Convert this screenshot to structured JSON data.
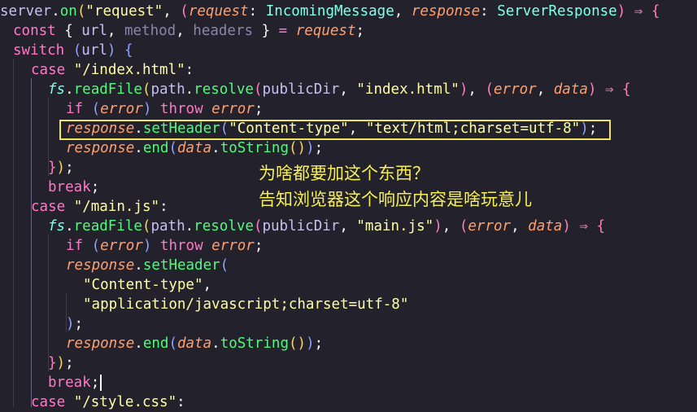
{
  "code": {
    "l1": {
      "t1": "server",
      "t2": ".",
      "t3": "on",
      "t4": "(",
      "t5": "\"request\"",
      "t6": ", ",
      "t7": "(",
      "t8": "request",
      "t9": ": ",
      "t10": "IncomingMessage",
      "t11": ", ",
      "t12": "response",
      "t13": ": ",
      "t14": "ServerResponse",
      "t15": ") ",
      "t16": "⇒",
      "t17": " ",
      "t18": "{"
    },
    "l2": {
      "t1": "const",
      "t2": " { ",
      "t3": "url",
      "t4": ", ",
      "t5": "method",
      "t6": ", ",
      "t7": "headers",
      "t8": " } ",
      "t9": "=",
      "t10": " ",
      "t11": "request",
      "t12": ";"
    },
    "l3": {
      "t1": "switch",
      "t2": " (",
      "t3": "url",
      "t4": ") ",
      "t5": "{"
    },
    "l4": {
      "t1": "case",
      "t2": " ",
      "t3": "\"/index.html\"",
      "t4": ":"
    },
    "l5": {
      "t1": "fs",
      "t2": ".",
      "t3": "readFile",
      "t4": "(",
      "t5": "path",
      "t6": ".",
      "t7": "resolve",
      "t8": "(",
      "t9": "publicDir",
      "t10": ", ",
      "t11": "\"index.html\"",
      "t12": ")",
      "t13": ", ",
      "t14": "(",
      "t15": "error",
      "t16": ", ",
      "t17": "data",
      "t18": ") ",
      "t19": "⇒",
      "t20": " ",
      "t21": "{"
    },
    "l6": {
      "t1": "if",
      "t2": " (",
      "t3": "error",
      "t4": ") ",
      "t5": "throw",
      "t6": " ",
      "t7": "error",
      "t8": ";"
    },
    "l7": {
      "t1": "response",
      "t2": ".",
      "t3": "setHeader",
      "t4": "(",
      "t5": "\"Content-type\"",
      "t6": ", ",
      "t7": "\"text/html;charset=utf-8\"",
      "t8": ")",
      "t9": ";"
    },
    "l8": {
      "t1": "response",
      "t2": ".",
      "t3": "end",
      "t4": "(",
      "t5": "data",
      "t6": ".",
      "t7": "toString",
      "t8": "()",
      "t9": ")",
      "t10": ";"
    },
    "l9": {
      "t1": "}",
      "t2": ")",
      "t3": ";"
    },
    "l10": {
      "t1": "break",
      "t2": ";"
    },
    "l11": {
      "t1": "case",
      "t2": " ",
      "t3": "\"/main.js\"",
      "t4": ":"
    },
    "l12": {
      "t1": "fs",
      "t2": ".",
      "t3": "readFile",
      "t4": "(",
      "t5": "path",
      "t6": ".",
      "t7": "resolve",
      "t8": "(",
      "t9": "publicDir",
      "t10": ", ",
      "t11": "\"main.js\"",
      "t12": ")",
      "t13": ", ",
      "t14": "(",
      "t15": "error",
      "t16": ", ",
      "t17": "data",
      "t18": ") ",
      "t19": "⇒",
      "t20": " ",
      "t21": "{"
    },
    "l13": {
      "t1": "if",
      "t2": " (",
      "t3": "error",
      "t4": ") ",
      "t5": "throw",
      "t6": " ",
      "t7": "error",
      "t8": ";"
    },
    "l14": {
      "t1": "response",
      "t2": ".",
      "t3": "setHeader",
      "t4": "("
    },
    "l15": {
      "t1": "\"Content-type\"",
      "t2": ","
    },
    "l16": {
      "t1": "\"application/javascript;charset=utf-8\""
    },
    "l17": {
      "t1": ")",
      "t2": ";"
    },
    "l18": {
      "t1": "response",
      "t2": ".",
      "t3": "end",
      "t4": "(",
      "t5": "data",
      "t6": ".",
      "t7": "toString",
      "t8": "()",
      "t9": ")",
      "t10": ";"
    },
    "l19": {
      "t1": "}",
      "t2": ")",
      "t3": ";"
    },
    "l20": {
      "t1": "break",
      "t2": ";"
    },
    "l21": {
      "t1": "case",
      "t2": " ",
      "t3": "\"/style.css\"",
      "t4": ":"
    }
  },
  "annotation": {
    "line1": "为啥都要加这个东西？",
    "line2": "告知浏览器这个响应内容是啥玩意儿"
  },
  "colors": {
    "background": "#22212c",
    "keyword": "#ff79c6",
    "function": "#50fa7b",
    "string": "#ffffa5",
    "highlight_box": "#f2e35f",
    "annotation_text": "#f6ef5a"
  }
}
